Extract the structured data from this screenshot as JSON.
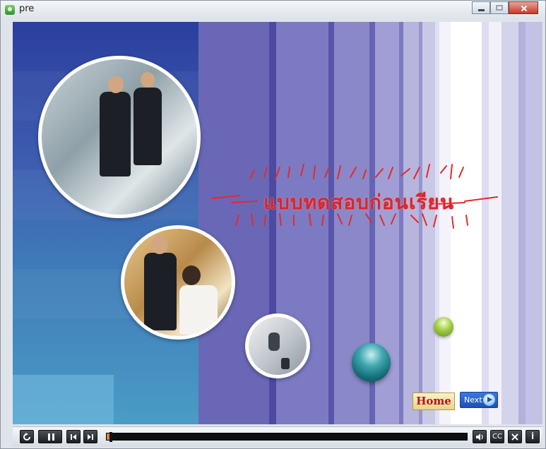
{
  "window": {
    "title": "pre"
  },
  "stage": {
    "heading": "แบบทดสอบก่อนเรียน",
    "home_label": "Home",
    "next_label": "Next"
  },
  "player": {
    "progress": 0.012,
    "buttons": [
      "rewind",
      "pause",
      "previous",
      "next",
      "volume",
      "cc",
      "close",
      "info"
    ],
    "cc_label": "CC",
    "info_label": "i"
  },
  "colors": {
    "heading": "#d8262c",
    "home_text": "#b2141e",
    "next_bg": "#2a62cc",
    "progress": "#e1802f"
  }
}
